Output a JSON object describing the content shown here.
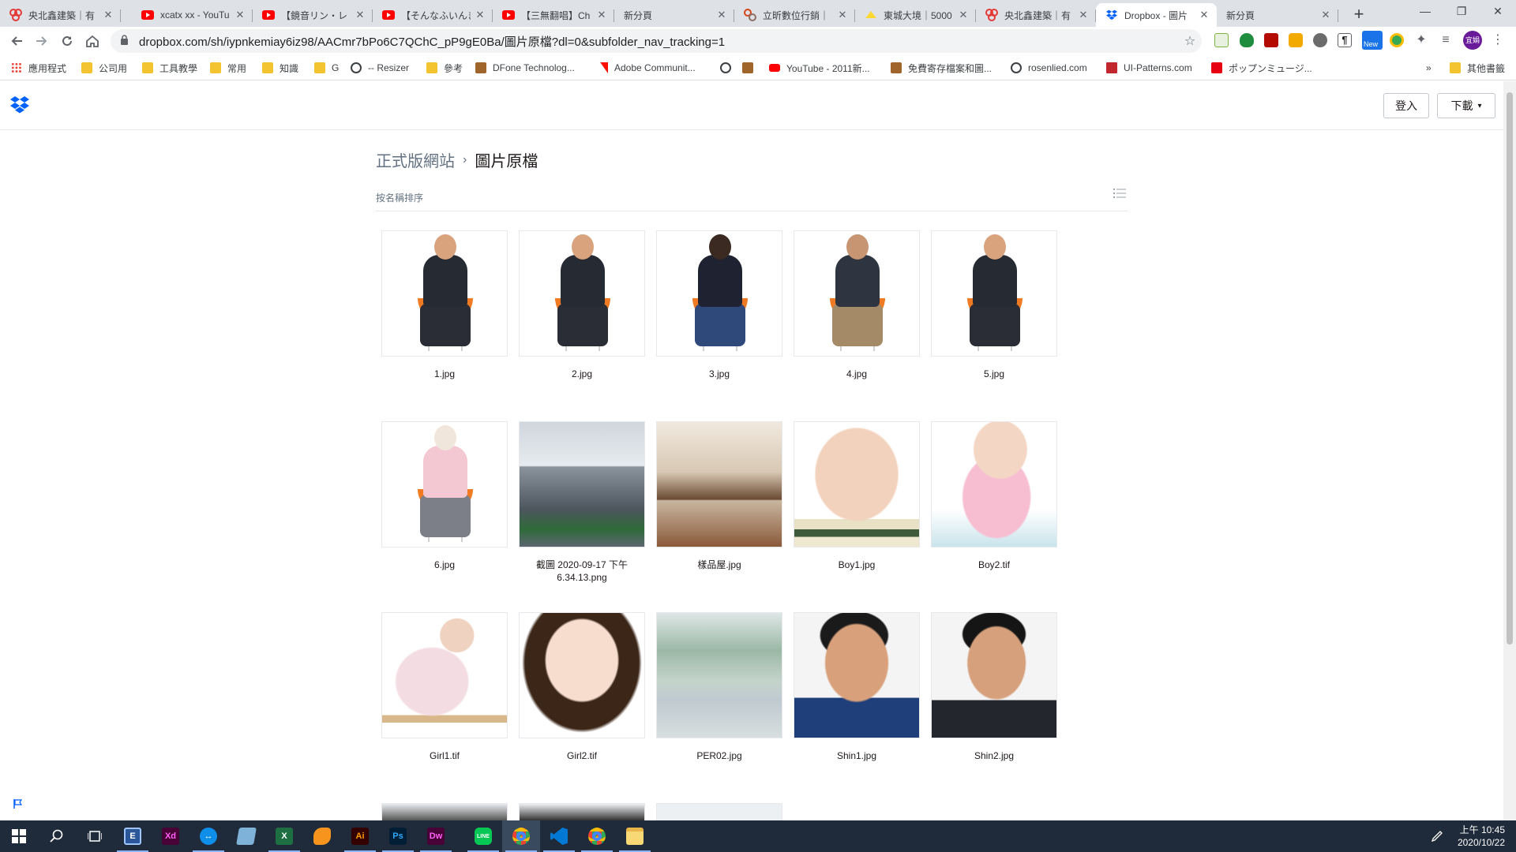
{
  "browser": {
    "tabs": [
      {
        "title": "央北鑫建築｜有",
        "icon": "pinwheel",
        "close": "✕"
      },
      {
        "title": "xcatx xx - YouTu",
        "icon": "youtube",
        "close": "✕"
      },
      {
        "title": "【鏡音リン・レ",
        "icon": "youtube",
        "close": "✕"
      },
      {
        "title": "【そんなふいんき",
        "icon": "youtube",
        "close": "✕"
      },
      {
        "title": "【三無翻唱】Ch",
        "icon": "youtube",
        "close": "✕"
      },
      {
        "title": "新分頁",
        "icon": "none",
        "close": "✕"
      },
      {
        "title": "立昕數位行銷｜",
        "icon": "pinwheel-gray",
        "close": "✕"
      },
      {
        "title": "東城大境｜5000",
        "icon": "yellow-bird",
        "close": "✕"
      },
      {
        "title": "央北鑫建築｜有",
        "icon": "pinwheel",
        "close": "✕"
      },
      {
        "title": "Dropbox - 圖片",
        "icon": "dropbox",
        "close": "✕",
        "active": true
      },
      {
        "title": "新分頁",
        "icon": "none",
        "close": "✕"
      }
    ],
    "new_tab": "+",
    "window_controls": {
      "minimize": "—",
      "maximize": "❐",
      "close": "✕"
    },
    "url": "dropbox.com/sh/iypnkemiay6iz98/AACmr7bPo6C7QChC_pP9gE0Ba/圖片原檔?dl=0&subfolder_nav_tracking=1",
    "bookmarks": [
      {
        "label": "應用程式",
        "icon": "apps-grid"
      },
      {
        "label": "公司用",
        "icon": "folder"
      },
      {
        "label": "工具教學",
        "icon": "folder"
      },
      {
        "label": "常用",
        "icon": "folder"
      },
      {
        "label": "知識",
        "icon": "folder"
      },
      {
        "label": "G",
        "icon": "folder"
      },
      {
        "label": "-- Resizer",
        "icon": "globe"
      },
      {
        "label": "參考",
        "icon": "folder"
      },
      {
        "label": "DFone Technolog...",
        "icon": "site"
      },
      {
        "label": "Adobe Communit...",
        "icon": "adobe"
      },
      {
        "label": "",
        "icon": "globe"
      },
      {
        "label": "",
        "icon": "site"
      },
      {
        "label": "YouTube - 2011新...",
        "icon": "youtube"
      },
      {
        "label": "免費寄存檔案和圖...",
        "icon": "site"
      },
      {
        "label": "rosenlied.com",
        "icon": "globe"
      },
      {
        "label": "UI-Patterns.com",
        "icon": "uip"
      },
      {
        "label": "ポップンミュージ...",
        "icon": "popn"
      }
    ],
    "bookmarks_overflow": "»",
    "other_bookmarks": "其他書籤",
    "profile_initials": "宜娟",
    "ext_new_badge": "New"
  },
  "dropbox": {
    "sign_in": "登入",
    "download": "下載",
    "download_caret": "▾",
    "breadcrumb": {
      "parent": "正式版網站",
      "separator": "›",
      "current": "圖片原檔"
    },
    "sort_label": "按名稱排序",
    "files": [
      {
        "name": "1.jpg",
        "art": "person-dark"
      },
      {
        "name": "2.jpg",
        "art": "person-dark"
      },
      {
        "name": "3.jpg",
        "art": "person-woman"
      },
      {
        "name": "4.jpg",
        "art": "person-casual"
      },
      {
        "name": "5.jpg",
        "art": "person-dark"
      },
      {
        "name": "6.jpg",
        "art": "person-pink"
      },
      {
        "name": "截圖 2020-09-17 下午 6.34.13.png",
        "art": "building"
      },
      {
        "name": "樣品屋.jpg",
        "art": "interior"
      },
      {
        "name": "Boy1.jpg",
        "art": "boy"
      },
      {
        "name": "Boy2.tif",
        "art": "girl-pink"
      },
      {
        "name": "Girl1.tif",
        "art": "girl-sitting"
      },
      {
        "name": "Girl2.tif",
        "art": "girl-face"
      },
      {
        "name": "PER02.jpg",
        "art": "park"
      },
      {
        "name": "Shin1.jpg",
        "art": "man-suit-blue"
      },
      {
        "name": "Shin2.jpg",
        "art": "man-suit-dark"
      }
    ]
  },
  "taskbar": {
    "apps": [
      {
        "name": "Xd",
        "color": "#470137",
        "fg": "#ff61f6"
      },
      {
        "name": "Ai",
        "color": "#330000",
        "fg": "#ff9a00"
      },
      {
        "name": "Ps",
        "color": "#001e36",
        "fg": "#31a8ff"
      },
      {
        "name": "Dw",
        "color": "#470137",
        "fg": "#ff61f6"
      }
    ],
    "time": "上午 10:45",
    "date": "2020/10/22"
  }
}
